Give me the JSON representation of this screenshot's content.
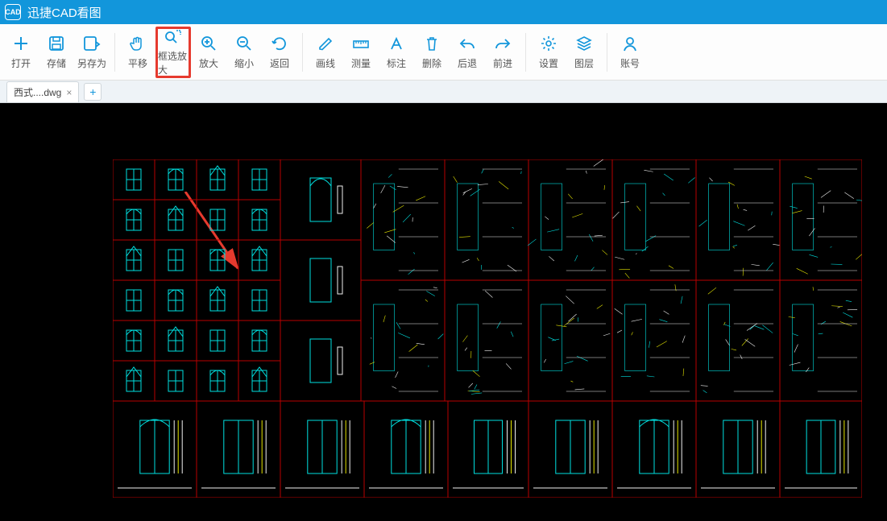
{
  "app": {
    "title": "迅捷CAD看图",
    "logo_text": "CAD"
  },
  "toolbar": {
    "groups": [
      [
        "打开",
        "存储",
        "另存为"
      ],
      [
        "平移",
        "框选放大",
        "放大",
        "缩小",
        "返回"
      ],
      [
        "画线",
        "测量",
        "标注",
        "删除",
        "后退",
        "前进"
      ],
      [
        "设置",
        "图层"
      ],
      [
        "账号"
      ]
    ],
    "open": "打开",
    "save": "存储",
    "saveas": "另存为",
    "pan": "平移",
    "zoombox": "框选放大",
    "zoomin": "放大",
    "zoomout": "缩小",
    "back": "返回",
    "line": "画线",
    "measure": "测量",
    "annotate": "标注",
    "delete": "删除",
    "undo": "后退",
    "redo": "前进",
    "settings": "设置",
    "layers": "图层",
    "account": "账号",
    "highlighted": "zoombox"
  },
  "tabs": {
    "active": {
      "label": "西式....dwg"
    }
  },
  "colors": {
    "accent": "#1296db",
    "highlight": "#e63a2e",
    "canvas": "#000000",
    "gridline": "#b80000",
    "cad_cyan": "#00e0e0",
    "cad_white": "#f0f0f0",
    "cad_yellow": "#e6e600"
  }
}
